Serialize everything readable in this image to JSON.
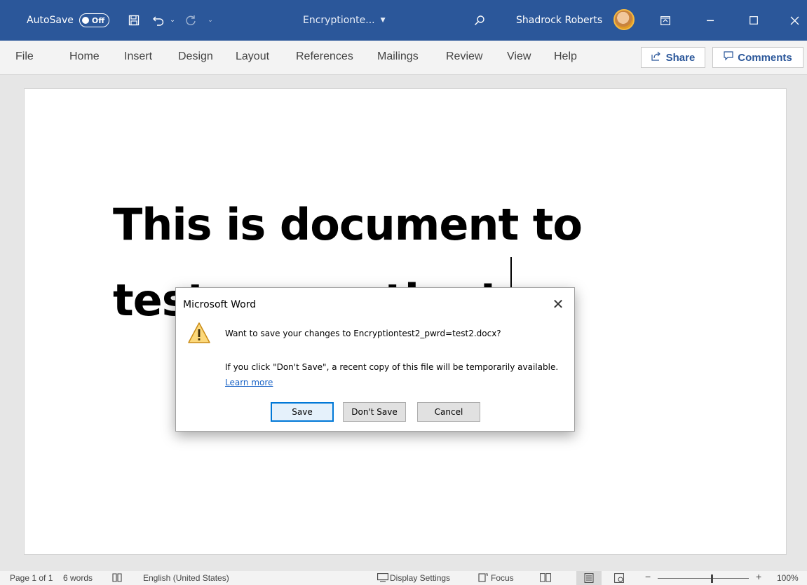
{
  "titlebar": {
    "autosave_label": "AutoSave",
    "autosave_state": "Off",
    "doc_title": "Encryptionte...",
    "user_name": "Shadrock Roberts",
    "bg_color": "#2b579a"
  },
  "menu": {
    "tabs": [
      "File",
      "Home",
      "Insert",
      "Design",
      "Layout",
      "References",
      "Mailings",
      "Review",
      "View",
      "Help"
    ],
    "share": "Share",
    "comments": "Comments"
  },
  "document": {
    "line1": "This is document to",
    "line2": "test encryption!"
  },
  "dialog": {
    "title": "Microsoft Word",
    "message": "Want to save your changes to Encryptiontest2_pwrd=test2.docx?",
    "info": "If you click \"Don't Save\", a recent copy of this file will be temporarily available.",
    "learn_more": "Learn more",
    "save": "Save",
    "dont_save": "Don't Save",
    "cancel": "Cancel"
  },
  "statusbar": {
    "page": "Page 1 of 1",
    "words": "6 words",
    "language": "English (United States)",
    "display_settings": "Display Settings",
    "focus": "Focus",
    "zoom_minus": "−",
    "zoom_plus": "+",
    "zoom": "100%"
  }
}
